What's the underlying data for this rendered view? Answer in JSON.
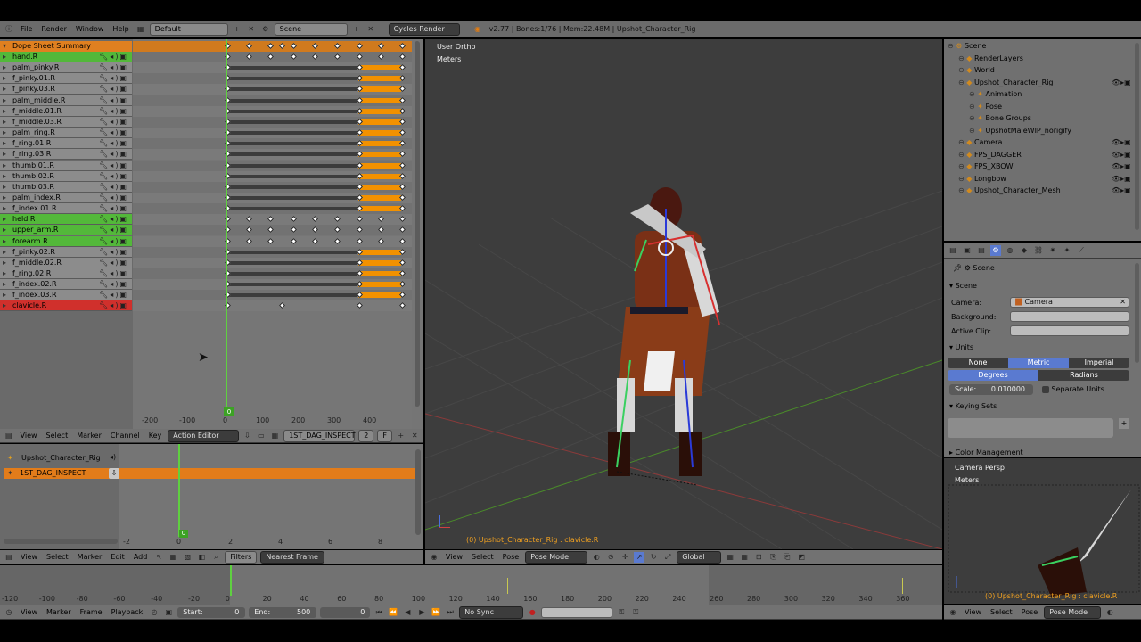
{
  "info_header": {
    "menus": [
      "File",
      "Render",
      "Window",
      "Help"
    ],
    "layout": "Default",
    "scene": "Scene",
    "engine": "Cycles Render",
    "stats": "v2.77 | Bones:1/76 | Mem:22.48M | Upshot_Character_Rig"
  },
  "dopesheet": {
    "summary": "Dope Sheet Summary",
    "channels": [
      {
        "name": "hand.R",
        "color": "#53b83a"
      },
      {
        "name": "palm_pinky.R",
        "color": "#8c8c8c"
      },
      {
        "name": "f_pinky.01.R",
        "color": "#8c8c8c"
      },
      {
        "name": "f_pinky.03.R",
        "color": "#8c8c8c"
      },
      {
        "name": "palm_middle.R",
        "color": "#8c8c8c"
      },
      {
        "name": "f_middle.01.R",
        "color": "#8c8c8c"
      },
      {
        "name": "f_middle.03.R",
        "color": "#8c8c8c"
      },
      {
        "name": "palm_ring.R",
        "color": "#8c8c8c"
      },
      {
        "name": "f_ring.01.R",
        "color": "#8c8c8c"
      },
      {
        "name": "f_ring.03.R",
        "color": "#8c8c8c"
      },
      {
        "name": "thumb.01.R",
        "color": "#8c8c8c"
      },
      {
        "name": "thumb.02.R",
        "color": "#8c8c8c"
      },
      {
        "name": "thumb.03.R",
        "color": "#8c8c8c"
      },
      {
        "name": "palm_index.R",
        "color": "#8c8c8c"
      },
      {
        "name": "f_index.01.R",
        "color": "#8c8c8c"
      },
      {
        "name": "held.R",
        "color": "#53b83a"
      },
      {
        "name": "upper_arm.R",
        "color": "#53b83a"
      },
      {
        "name": "forearm.R",
        "color": "#53b83a"
      },
      {
        "name": "f_pinky.02.R",
        "color": "#8c8c8c"
      },
      {
        "name": "f_middle.02.R",
        "color": "#8c8c8c"
      },
      {
        "name": "f_ring.02.R",
        "color": "#8c8c8c"
      },
      {
        "name": "f_index.02.R",
        "color": "#8c8c8c"
      },
      {
        "name": "f_index.03.R",
        "color": "#8c8c8c"
      },
      {
        "name": "clavicle.R",
        "color": "#d0302c"
      }
    ],
    "ruler": [
      "-200",
      "-100",
      "0",
      "100",
      "200",
      "300",
      "400"
    ],
    "current_frame": "0",
    "header_menus": [
      "View",
      "Select",
      "Marker",
      "Channel",
      "Key"
    ],
    "mode": "Action Editor",
    "action": "1ST_DAG_INSPECT",
    "users": "2",
    "fake": "F"
  },
  "nla": {
    "object": "Upshot_Character_Rig",
    "strip": "1ST_DAG_INSPECT",
    "ruler": [
      "-2",
      "0",
      "2",
      "4",
      "6",
      "8"
    ],
    "current_frame": "0",
    "header_menus": [
      "View",
      "Select",
      "Marker",
      "Edit",
      "Add"
    ],
    "filters": "Filters",
    "snap": "Nearest Frame"
  },
  "viewport": {
    "view_name": "User Ortho",
    "units": "Meters",
    "status": "(0) Upshot_Character_Rig : clavicle.R",
    "header_menus": [
      "View",
      "Select",
      "Pose"
    ],
    "mode": "Pose Mode",
    "orientation": "Global"
  },
  "outliner": {
    "items": [
      {
        "label": "Scene",
        "indent": 0
      },
      {
        "label": "RenderLayers",
        "indent": 1
      },
      {
        "label": "World",
        "indent": 1
      },
      {
        "label": "Upshot_Character_Rig",
        "indent": 1
      },
      {
        "label": "Animation",
        "indent": 2
      },
      {
        "label": "Pose",
        "indent": 2
      },
      {
        "label": "Bone Groups",
        "indent": 2
      },
      {
        "label": "UpshotMaleWIP_norigify",
        "indent": 2
      },
      {
        "label": "Camera",
        "indent": 1
      },
      {
        "label": "FPS_DAGGER",
        "indent": 1
      },
      {
        "label": "FPS_XBOW",
        "indent": 1
      },
      {
        "label": "Longbow",
        "indent": 1
      },
      {
        "label": "Upshot_Character_Mesh",
        "indent": 1
      }
    ]
  },
  "properties": {
    "breadcrumb": "Scene",
    "scene_panel": "Scene",
    "camera_label": "Camera:",
    "camera_value": "Camera",
    "background_label": "Background:",
    "active_clip_label": "Active Clip:",
    "units_panel": "Units",
    "unit_systems": [
      "None",
      "Metric",
      "Imperial"
    ],
    "rotation_units": [
      "Degrees",
      "Radians"
    ],
    "scale": "Scale:",
    "scale_value": "0.010000",
    "separate_units": "Separate Units",
    "keying_sets": "Keying Sets",
    "color_management": "Color Management"
  },
  "camera_view": {
    "view_name": "Camera Persp",
    "units": "Meters",
    "status": "(0) Upshot_Character_Rig : clavicle.R",
    "header_menus": [
      "View",
      "Select",
      "Pose"
    ],
    "mode": "Pose Mode"
  },
  "timeline": {
    "ruler": [
      "-120",
      "-100",
      "-80",
      "-60",
      "-40",
      "-20",
      "0",
      "20",
      "40",
      "60",
      "80",
      "100",
      "120",
      "140",
      "160",
      "180",
      "200",
      "220",
      "240",
      "260",
      "280",
      "300",
      "320",
      "340",
      "360"
    ],
    "header_menus": [
      "View",
      "Marker",
      "Frame",
      "Playback"
    ],
    "start_label": "Start:",
    "start_value": "0",
    "end_label": "End:",
    "end_value": "500",
    "current": "0",
    "sync": "No Sync"
  }
}
